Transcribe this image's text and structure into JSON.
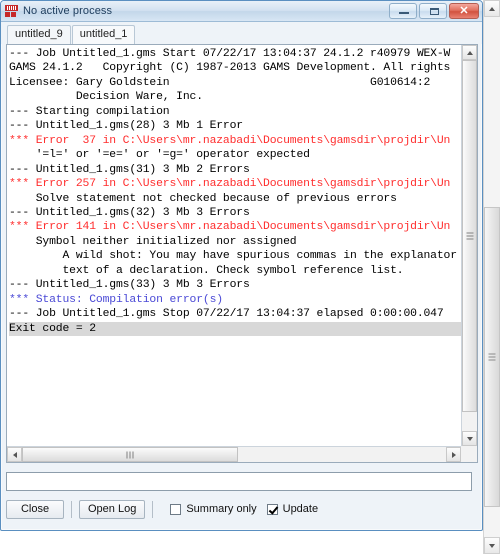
{
  "window": {
    "title": "No active process",
    "icon": "gams-app-icon",
    "controls": {
      "minimize": "—",
      "maximize": "❐",
      "close": "✕"
    }
  },
  "tabs": [
    {
      "label": "untitled_9",
      "active": false
    },
    {
      "label": "untitled_1",
      "active": true
    }
  ],
  "log": {
    "lines": [
      {
        "text": "--- Job Untitled_1.gms Start 07/22/17 13:04:37 24.1.2 r40979 WEX-W",
        "style": "plain"
      },
      {
        "text": "GAMS 24.1.2   Copyright (C) 1987-2013 GAMS Development. All rights",
        "style": "plain"
      },
      {
        "text": "Licensee: Gary Goldstein                              G010614:2",
        "style": "plain"
      },
      {
        "text": "          Decision Ware, Inc.",
        "style": "plain"
      },
      {
        "text": "--- Starting compilation",
        "style": "plain"
      },
      {
        "text": "--- Untitled_1.gms(28) 3 Mb 1 Error",
        "style": "plain"
      },
      {
        "text": "*** Error  37 in C:\\Users\\mr.nazabadi\\Documents\\gamsdir\\projdir\\Un",
        "style": "error"
      },
      {
        "text": "    '=l=' or '=e=' or '=g=' operator expected",
        "style": "plain"
      },
      {
        "text": "--- Untitled_1.gms(31) 3 Mb 2 Errors",
        "style": "plain"
      },
      {
        "text": "*** Error 257 in C:\\Users\\mr.nazabadi\\Documents\\gamsdir\\projdir\\Un",
        "style": "error"
      },
      {
        "text": "    Solve statement not checked because of previous errors",
        "style": "plain"
      },
      {
        "text": "--- Untitled_1.gms(32) 3 Mb 3 Errors",
        "style": "plain"
      },
      {
        "text": "*** Error 141 in C:\\Users\\mr.nazabadi\\Documents\\gamsdir\\projdir\\Un",
        "style": "error"
      },
      {
        "text": "    Symbol neither initialized nor assigned",
        "style": "plain"
      },
      {
        "text": "        A wild shot: You may have spurious commas in the explanator",
        "style": "plain"
      },
      {
        "text": "        text of a declaration. Check symbol reference list.",
        "style": "plain"
      },
      {
        "text": "--- Untitled_1.gms(33) 3 Mb 3 Errors",
        "style": "plain"
      },
      {
        "text": "*** Status: Compilation error(s)",
        "style": "status"
      },
      {
        "text": "--- Job Untitled_1.gms Stop 07/22/17 13:04:37 elapsed 0:00:00.047",
        "style": "plain"
      },
      {
        "text": "Exit code = 2",
        "style": "selected"
      }
    ]
  },
  "command": {
    "value": "",
    "placeholder": ""
  },
  "bottom": {
    "close_label": "Close",
    "open_log_label": "Open Log",
    "summary_only": {
      "label": "Summary only",
      "checked": false
    },
    "update": {
      "label": "Update",
      "checked": true
    }
  },
  "colors": {
    "error": "#ff2d2d",
    "status": "#4a49d6",
    "text": "#000000",
    "window_border": "#5a8fc0",
    "selection": "#d8d8d8"
  }
}
